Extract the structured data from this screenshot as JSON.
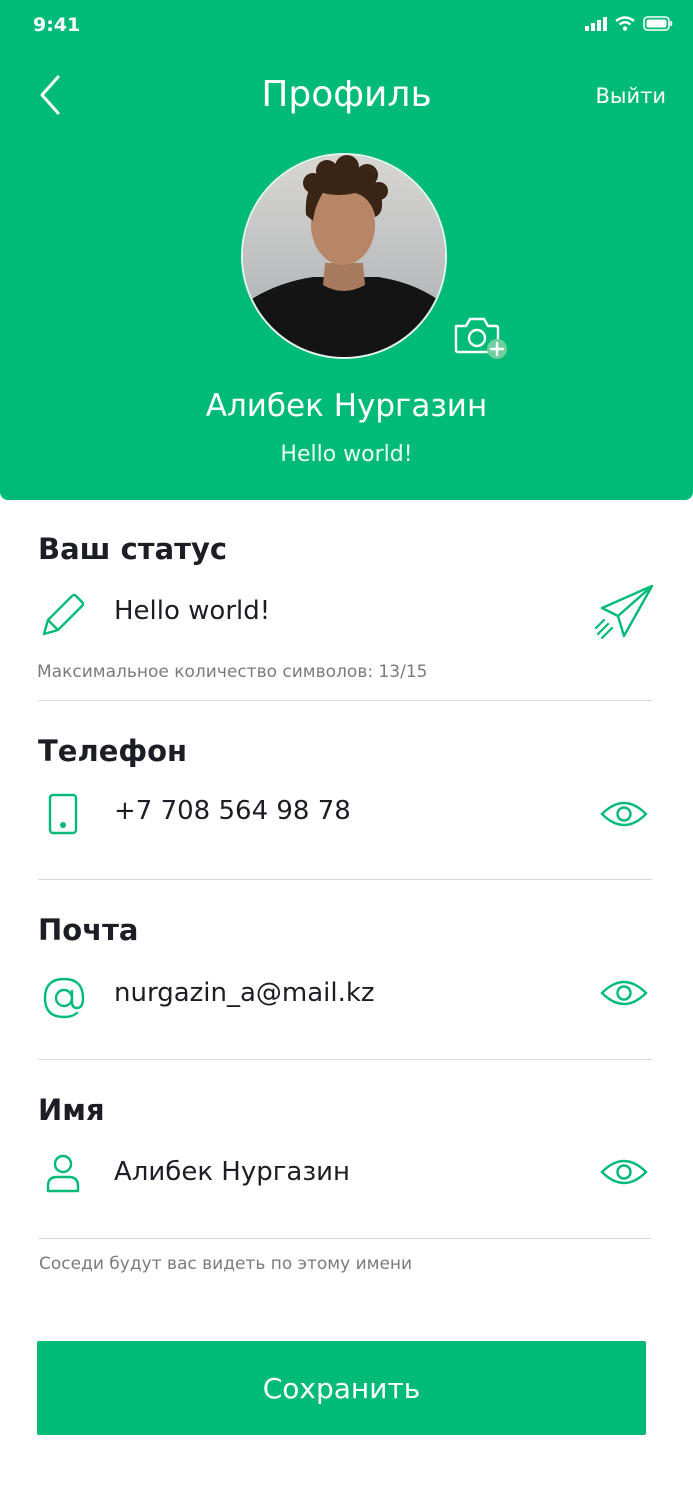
{
  "status_bar": {
    "time": "9:41"
  },
  "header": {
    "title": "Профиль",
    "logout_label": "Выйти",
    "user_name": "Алибек Нургазин",
    "user_status": "Hello world!"
  },
  "status_section": {
    "title": "Ваш статус",
    "value": "Hello world!",
    "hint": "Максимальное количество символов: 13/15"
  },
  "phone_section": {
    "title": "Телефон",
    "value": "+7 708 564 98 78"
  },
  "email_section": {
    "title": "Почта",
    "value": "nurgazin_a@mail.kz"
  },
  "name_section": {
    "title": "Имя",
    "value": "Алибек Нургазин",
    "hint": "Соседи будут вас видеть по этому имени"
  },
  "save_button": {
    "label": "Сохранить"
  },
  "colors": {
    "accent": "#00bb77",
    "text": "#1d1d26",
    "hint": "#7a7a82"
  },
  "icons": [
    "back-icon",
    "camera-add-icon",
    "pencil-icon",
    "paper-plane-icon",
    "phone-icon",
    "eye-icon",
    "at-icon",
    "user-icon"
  ]
}
